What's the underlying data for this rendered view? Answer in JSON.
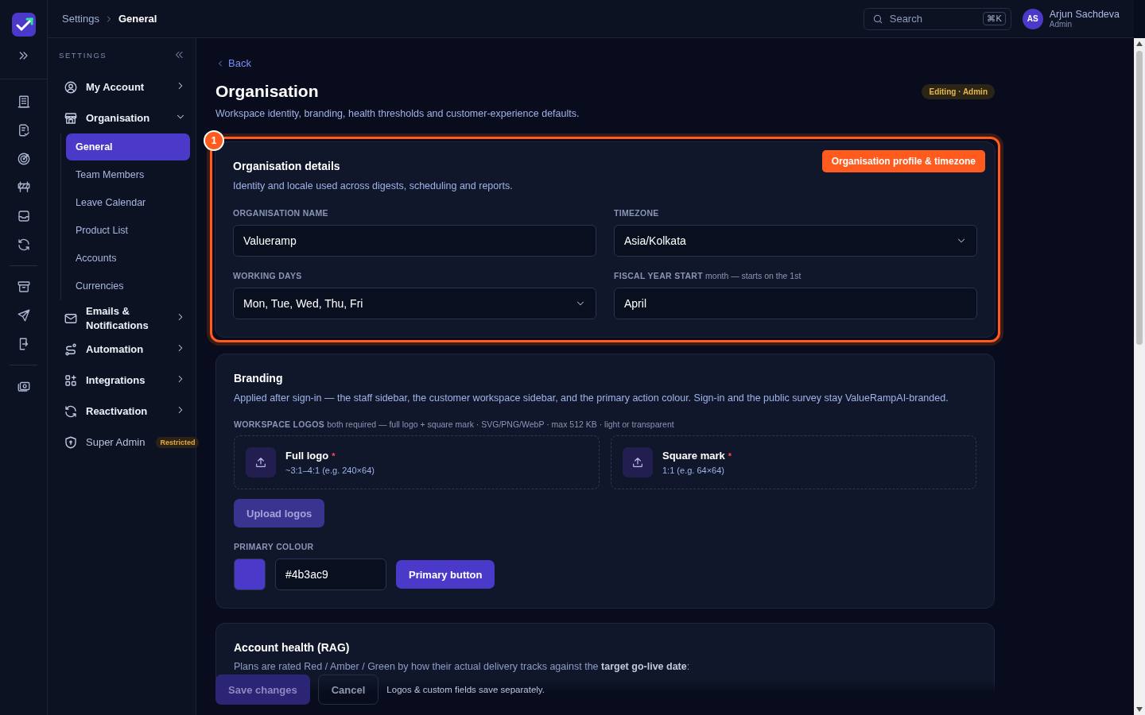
{
  "breadcrumb": [
    {
      "label": "Settings",
      "selected": false
    },
    {
      "label": "General",
      "selected": true
    }
  ],
  "search": {
    "placeholder": "Search",
    "shortcut": "⌘K"
  },
  "user": {
    "initials": "AS",
    "name": "Arjun Sachdeva",
    "role": "Admin"
  },
  "sidebar": {
    "heading": "SETTINGS",
    "items": [
      {
        "label": "My Account",
        "kind": "group",
        "expanded": false
      },
      {
        "label": "Organisation",
        "kind": "group",
        "expanded": true,
        "children": [
          {
            "label": "General",
            "selected": true
          },
          {
            "label": "Team Members",
            "selected": false
          },
          {
            "label": "Leave Calendar",
            "selected": false
          },
          {
            "label": "Product List",
            "selected": false
          },
          {
            "label": "Accounts",
            "selected": false
          },
          {
            "label": "Currencies",
            "selected": false
          }
        ]
      },
      {
        "label": "Emails & Notifications",
        "kind": "group",
        "expanded": false
      },
      {
        "label": "Automation",
        "kind": "group",
        "expanded": false
      },
      {
        "label": "Integrations",
        "kind": "group",
        "expanded": false
      },
      {
        "label": "Reactivation",
        "kind": "group",
        "expanded": false
      },
      {
        "label": "Super Admin",
        "kind": "restricted",
        "badge": "Restricted"
      }
    ]
  },
  "page": {
    "back": "Back",
    "title": "Organisation",
    "badge": "Editing · Admin",
    "subtitle": "Workspace identity, branding, health thresholds and customer-experience defaults."
  },
  "details": {
    "title": "Organisation details",
    "subtitle": "Identity and locale used across digests, scheduling and reports.",
    "annotation": {
      "number": "1",
      "label": "Organisation profile & timezone"
    },
    "fields": [
      {
        "label": "ORGANISATION NAME",
        "kind": "input",
        "value": "Valueramp"
      },
      {
        "label": "TIMEZONE",
        "kind": "select",
        "value": "Asia/Kolkata"
      },
      {
        "label": "WORKING DAYS",
        "kind": "select",
        "value": "Mon, Tue, Wed, Thu, Fri"
      },
      {
        "label": "FISCAL YEAR START",
        "hint": "month — starts on the 1st",
        "kind": "input",
        "value": "April"
      }
    ]
  },
  "branding": {
    "title": "Branding",
    "subtitle": "Applied after sign-in — the staff sidebar, the customer workspace sidebar, and the primary action colour. Sign-in and the public survey stay ValueRampAI-branded.",
    "logos_label": "WORKSPACE LOGOS",
    "logos_hint": "both required — full logo + square mark · SVG/PNG/WebP · max 512 KB · light or transparent",
    "logos": [
      {
        "title": "Full logo",
        "required_mark": "*",
        "sub": "~3:1–4:1 (e.g. 240×64)"
      },
      {
        "title": "Square mark",
        "required_mark": "*",
        "sub": "1:1 (e.g. 64×64)"
      }
    ],
    "upload_button": {
      "label": "Upload logos",
      "disabled": true
    },
    "colour_label": "PRIMARY COLOUR",
    "colour": "#4b3ac9",
    "preview_button": "Primary button"
  },
  "health": {
    "title": "Account health (RAG)",
    "text": "Plans are rated Red / Amber / Green by how their actual delivery tracks against the **target go-live date**:"
  },
  "footer": {
    "save": {
      "label": "Save changes",
      "disabled": true
    },
    "cancel": "Cancel",
    "note": "Logos & custom fields save separately."
  }
}
